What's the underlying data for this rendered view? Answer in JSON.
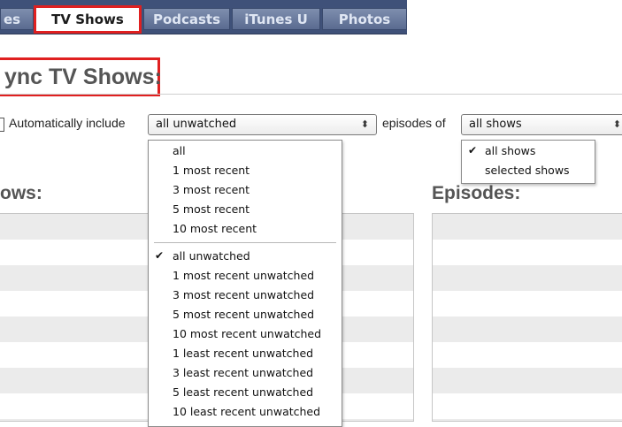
{
  "tabs": [
    {
      "label": "es"
    },
    {
      "label": "TV Shows"
    },
    {
      "label": "Podcasts"
    },
    {
      "label": "iTunes U"
    },
    {
      "label": "Photos"
    }
  ],
  "colors": {
    "tab_bar": "#3f5179",
    "highlight": "#e02020",
    "heading": "#555555"
  },
  "title": "ync TV Shows:",
  "auto_include": {
    "label": "Automatically include",
    "selected_episodes": "all unwatched",
    "connector": "episodes of",
    "selected_shows": "all shows"
  },
  "episode_options": {
    "group1": [
      "all",
      "1 most recent",
      "3 most recent",
      "5 most recent",
      "10 most recent"
    ],
    "group2": [
      "all unwatched",
      "1 most recent unwatched",
      "3 most recent unwatched",
      "5 most recent unwatched",
      "10 most recent unwatched",
      "1 least recent unwatched",
      "3 least recent unwatched",
      "5 least recent unwatched",
      "10 least recent unwatched"
    ]
  },
  "show_options": [
    "all shows",
    "selected shows"
  ],
  "checkmark": "✔",
  "select_arrows": "⬍",
  "headings": {
    "shows": "ows:",
    "episodes": "Episodes:"
  }
}
